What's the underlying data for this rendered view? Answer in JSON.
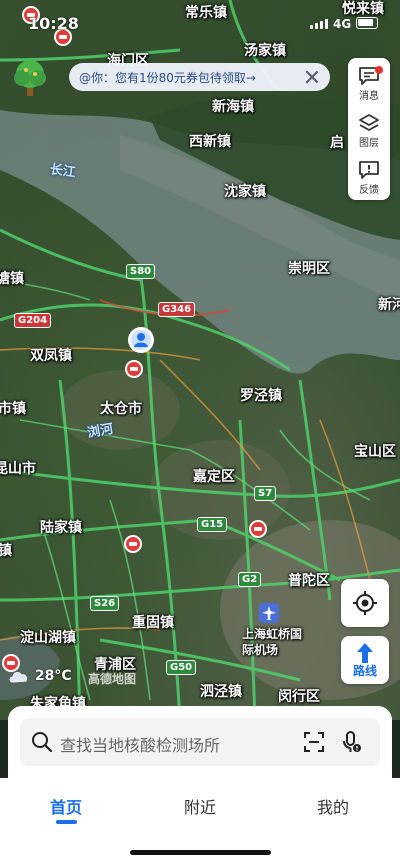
{
  "status_bar": {
    "time": "10:28",
    "network": "4G"
  },
  "banner": {
    "text": "@你：您有1份80元券包待领取→"
  },
  "toolbar": {
    "message_label": "消息",
    "layers_label": "图层",
    "feedback_label": "反馈"
  },
  "map": {
    "places": {
      "changle": "常乐镇",
      "yuele": "悦来镇",
      "haimen": "海门区",
      "tangjia": "汤家镇",
      "xinhai": "新海镇",
      "xixin": "西新镇",
      "qi": "启",
      "shenxing": "沈家镇",
      "chongming": "崇明区",
      "xinhe": "新河",
      "tang": "塘镇",
      "shuangfeng": "双凤镇",
      "taicang": "太仓市",
      "shizhen": "市镇",
      "luojing": "罗泾镇",
      "baoshan": "宝山区",
      "kunshan": "昆山市",
      "jiading": "嘉定区",
      "lujia": "陆家镇",
      "zhen": "镇",
      "putuo": "普陀区",
      "dianshanhu": "淀山湖镇",
      "chonggu": "重固镇",
      "hongqiao": "上海虹桥国际机场",
      "qingpu": "青浦区",
      "sijing": "泗泾镇",
      "minhang": "闵行区",
      "zhujiajiao": "朱家角镇",
      "hu": "湖"
    },
    "river": {
      "changjiang": "长江",
      "liuhe": "浏河"
    },
    "roads": {
      "s80": "S80",
      "g346": "G346",
      "g204": "G204",
      "s7": "S7",
      "g15": "G15",
      "g2": "G2",
      "s26": "S26",
      "g50": "G50"
    },
    "watermark": "高德地图"
  },
  "weather": {
    "temp": "28°C",
    "icon": "cloud-icon"
  },
  "route_button": {
    "label": "路线"
  },
  "search": {
    "placeholder": "查找当地核酸检测场所"
  },
  "tabs": [
    {
      "label": "首页",
      "active": true
    },
    {
      "label": "附近",
      "active": false
    },
    {
      "label": "我的",
      "active": false
    }
  ],
  "colors": {
    "accent": "#1a6fe8",
    "road_green": "#4fd16a",
    "notice_red": "#e8322f"
  }
}
